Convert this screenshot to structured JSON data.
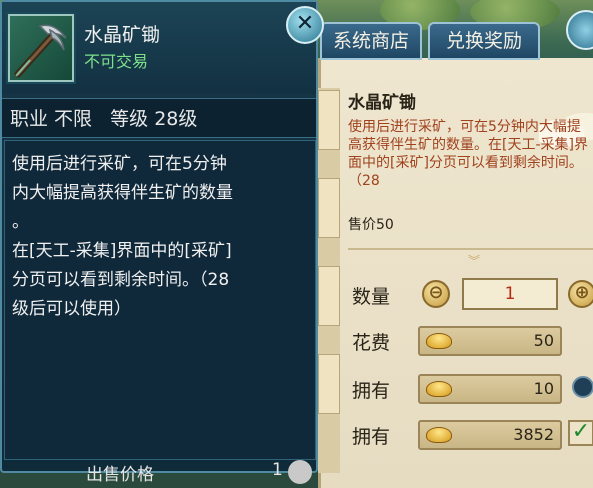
{
  "shop": {
    "tabs": [
      "系统商店",
      "兑换奖励"
    ],
    "detail": {
      "name": "水晶矿锄",
      "description": "使用后进行采矿，可在5分钟内大幅提高获得伴生矿的数量。在[天工-采集]界面中的[采矿]分页可以看到剩余时间。（28",
      "price_label": "售价50"
    },
    "quantity": {
      "label": "数量",
      "value": "1",
      "minus": "⊖",
      "plus": "⊕"
    },
    "cost": {
      "label": "花费",
      "value": "50"
    },
    "owned_1": {
      "label": "拥有",
      "value": "10"
    },
    "owned_2": {
      "label": "拥有",
      "value": "3852"
    },
    "check_icon": "✓"
  },
  "tooltip": {
    "item_name": "水晶矿锄",
    "trade_status": "不可交易",
    "close_icon": "✕",
    "stats": "职业 不限   等级 28级",
    "description_lines": [
      "使用后进行采矿，可在5分钟",
      "内大幅提高获得伴生矿的数量",
      "。",
      "在[天工-采集]界面中的[采矿]",
      "分页可以看到剩余时间。（28",
      "级后可以使用）"
    ],
    "sale_price_label": "出售价格",
    "sale_price_value": "1"
  },
  "colors": {
    "tooltip_bg": "#173646",
    "trade_green": "#7ee08a",
    "shop_desc_red": "#a0421e",
    "qty_red": "#b52a12"
  }
}
